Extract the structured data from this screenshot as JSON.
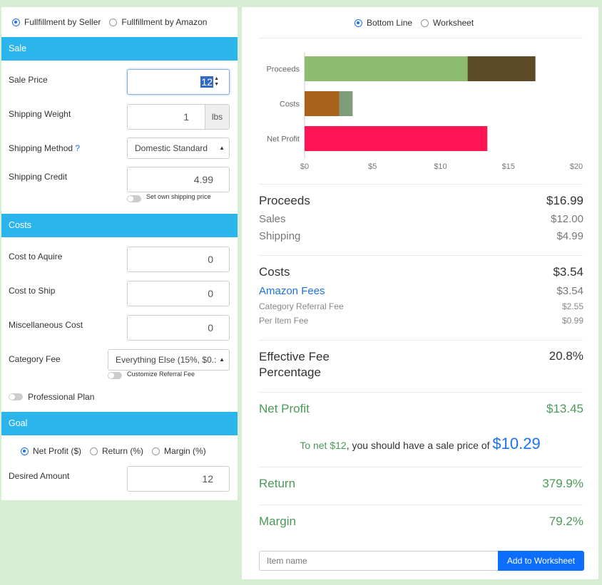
{
  "fulfillment": {
    "seller_label": "Fullfillment by Seller",
    "amazon_label": "Fullfillment by Amazon",
    "selected": "seller"
  },
  "sale": {
    "header": "Sale",
    "sale_price_label": "Sale Price",
    "sale_price_value": "12",
    "shipping_weight_label": "Shipping Weight",
    "shipping_weight_value": "1",
    "shipping_weight_unit": "lbs",
    "shipping_method_label": "Shipping Method",
    "shipping_method_help": "?",
    "shipping_method_value": "Domestic Standard",
    "shipping_credit_label": "Shipping Credit",
    "shipping_credit_value": "4.99",
    "own_shipping_toggle_label": "Set own shipping price"
  },
  "costs": {
    "header": "Costs",
    "aquire_label": "Cost to Aquire",
    "aquire_value": "0",
    "ship_label": "Cost to Ship",
    "ship_value": "0",
    "misc_label": "Miscellaneous Cost",
    "misc_value": "0",
    "category_label": "Category Fee",
    "category_value": "Everything Else (15%, $0.:",
    "custom_referral_label": "Customize Referral Fee",
    "professional_plan_label": "Professional Plan"
  },
  "goal": {
    "header": "Goal",
    "net_profit_label": "Net Profit ($)",
    "return_label": "Return (%)",
    "margin_label": "Margin (%)",
    "selected": "net_profit",
    "desired_amount_label": "Desired Amount",
    "desired_amount_value": "12"
  },
  "view": {
    "bottom_line_label": "Bottom Line",
    "worksheet_label": "Worksheet",
    "selected": "bottom_line"
  },
  "chart_data": {
    "type": "bar",
    "orientation": "horizontal",
    "stacked": true,
    "categories": [
      "Proceeds",
      "Costs",
      "Net Profit"
    ],
    "segments": [
      {
        "category": "Proceeds",
        "values": [
          12.0,
          4.99
        ],
        "colors": [
          "#8dbb6f",
          "#5d4a29"
        ]
      },
      {
        "category": "Costs",
        "values": [
          2.55,
          0.99
        ],
        "colors": [
          "#a8621c",
          "#7d9e78"
        ]
      },
      {
        "category": "Net Profit",
        "values": [
          13.45
        ],
        "colors": [
          "#ff1553"
        ]
      }
    ],
    "xlim": [
      0,
      20
    ],
    "xticks": [
      "$0",
      "$5",
      "$10",
      "$15",
      "$20"
    ],
    "grid": false
  },
  "summary": {
    "proceeds_label": "Proceeds",
    "proceeds_value": "$16.99",
    "sales_label": "Sales",
    "sales_value": "$12.00",
    "shipping_label": "Shipping",
    "shipping_value": "$4.99",
    "costs_label": "Costs",
    "costs_value": "$3.54",
    "amazon_fees_label": "Amazon Fees",
    "amazon_fees_value": "$3.54",
    "referral_fee_label": "Category Referral Fee",
    "referral_fee_value": "$2.55",
    "per_item_fee_label": "Per Item Fee",
    "per_item_fee_value": "$0.99",
    "effective_fee_label_1": "Effective Fee",
    "effective_fee_label_2": "Percentage",
    "effective_fee_value": "20.8%",
    "net_profit_label": "Net Profit",
    "net_profit_value": "$13.45",
    "goal_prefix": "To net $12",
    "goal_middle": ", you should have a sale price of ",
    "goal_price": "$10.29",
    "return_label": "Return",
    "return_value": "379.9%",
    "margin_label": "Margin",
    "margin_value": "79.2%"
  },
  "worksheet": {
    "item_placeholder": "Item name",
    "add_button": "Add to Worksheet"
  },
  "colors": {
    "accent": "#2bb5ec",
    "primary": "#0d6efd",
    "positive": "#4a9a57"
  }
}
